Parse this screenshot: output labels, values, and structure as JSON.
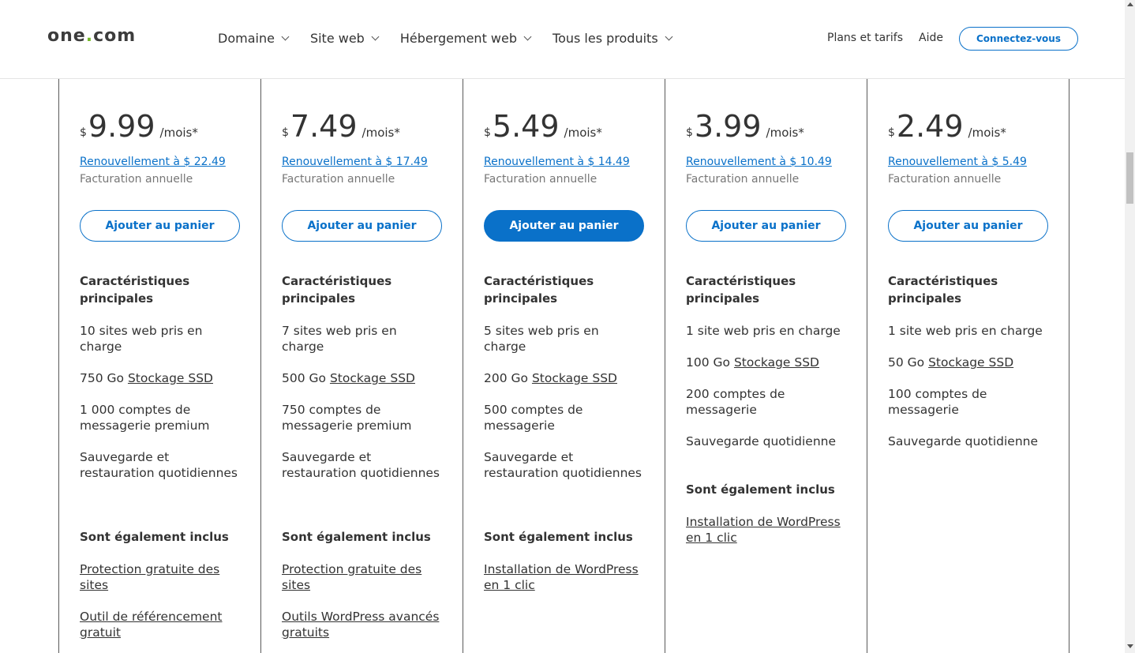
{
  "header": {
    "logo_text": "one",
    "logo_dot": ".",
    "logo_suffix": "com",
    "nav": [
      "Domaine",
      "Site web",
      "Hébergement web",
      "Tous les produits"
    ],
    "plans_link": "Plans et tarifs",
    "help_link": "Aide",
    "connect_label": "Connectez-vous"
  },
  "colors": {
    "accent": "#0a71c9",
    "logo_dot": "#76b82a"
  },
  "plans": [
    {
      "currency": "$",
      "price": "9.99",
      "period": "/mois*",
      "renewal": "Renouvellement à $ 22.49",
      "billing": "Facturation annuelle",
      "cart": "Ajouter au panier",
      "main_title": "Caractéristiques principales",
      "sites": "10 sites web pris en charge",
      "storage_amount": "750 Go",
      "storage_link": "Stockage SSD",
      "email": "1 000 comptes de messagerie premium",
      "backup": "Sauvegarde et restauration quotidiennes",
      "also_title": "Sont également inclus",
      "extras": [
        "Protection gratuite des sites",
        "Outil de référencement gratuit"
      ]
    },
    {
      "currency": "$",
      "price": "7.49",
      "period": "/mois*",
      "renewal": "Renouvellement à $ 17.49",
      "billing": "Facturation annuelle",
      "cart": "Ajouter au panier",
      "main_title": "Caractéristiques principales",
      "sites": "7 sites web pris en charge",
      "storage_amount": "500 Go",
      "storage_link": "Stockage SSD",
      "email": "750 comptes de messagerie premium",
      "backup": "Sauvegarde et restauration quotidiennes",
      "also_title": "Sont également inclus",
      "extras": [
        "Protection gratuite des sites",
        "Outils WordPress avancés gratuits"
      ]
    },
    {
      "currency": "$",
      "price": "5.49",
      "period": "/mois*",
      "renewal": "Renouvellement à $ 14.49",
      "billing": "Facturation annuelle",
      "cart": "Ajouter au panier",
      "main_title": "Caractéristiques principales",
      "sites": "5 sites web pris en charge",
      "storage_amount": "200 Go",
      "storage_link": "Stockage SSD",
      "email": "500 comptes de messagerie",
      "backup": "Sauvegarde et restauration quotidiennes",
      "also_title": "Sont également inclus",
      "extras": [
        "Installation de WordPress en 1 clic"
      ]
    },
    {
      "currency": "$",
      "price": "3.99",
      "period": "/mois*",
      "renewal": "Renouvellement à $ 10.49",
      "billing": "Facturation annuelle",
      "cart": "Ajouter au panier",
      "main_title": "Caractéristiques principales",
      "sites": "1 site web pris en charge",
      "storage_amount": "100 Go",
      "storage_link": "Stockage SSD",
      "email": "200 comptes de messagerie",
      "backup": "Sauvegarde quotidienne",
      "also_title": "Sont également inclus",
      "extras": [
        "Installation de WordPress en 1 clic"
      ]
    },
    {
      "currency": "$",
      "price": "2.49",
      "period": "/mois*",
      "renewal": "Renouvellement à $ 5.49",
      "billing": "Facturation annuelle",
      "cart": "Ajouter au panier",
      "main_title": "Caractéristiques principales",
      "sites": "1 site web pris en charge",
      "storage_amount": "50 Go",
      "storage_link": "Stockage SSD",
      "email": "100 comptes de messagerie",
      "backup": "Sauvegarde quotidienne"
    }
  ]
}
